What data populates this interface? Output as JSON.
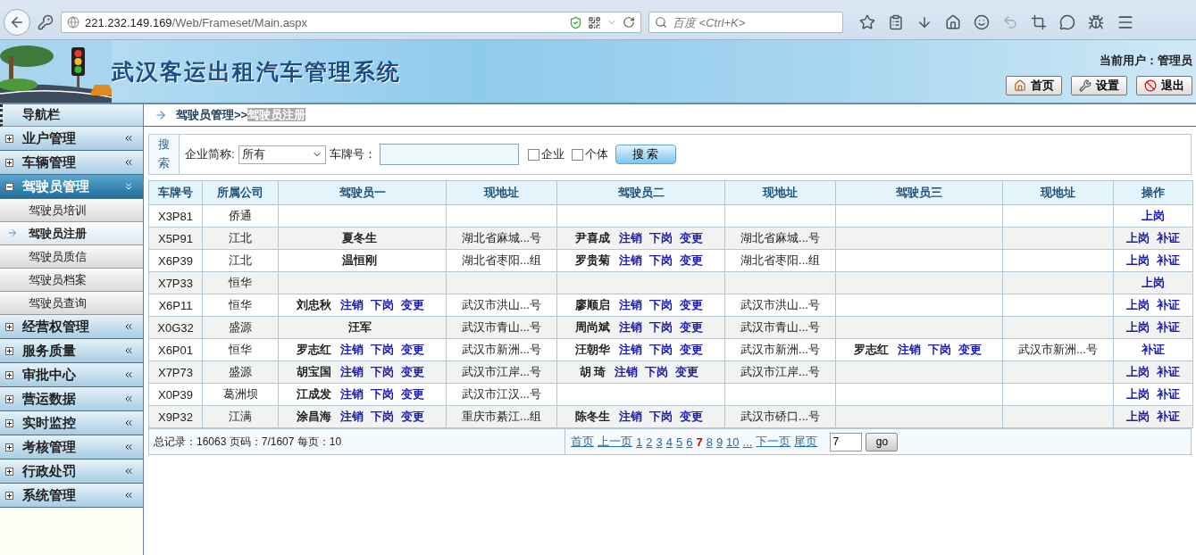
{
  "browser": {
    "url_host": "221.232.149.169",
    "url_path": "/Web/Frameset/Main.aspx",
    "search_placeholder": "百度 <Ctrl+K>"
  },
  "header": {
    "title": "武汉客运出租汽车管理系统",
    "user": "当前用户：管理员",
    "buttons": [
      {
        "kind": "home",
        "label": "首页"
      },
      {
        "kind": "settings",
        "label": "设置"
      },
      {
        "kind": "logout",
        "label": "退出"
      }
    ]
  },
  "sidebar": {
    "title": "导航栏",
    "groups": [
      {
        "label": "业户管理",
        "expanded": false
      },
      {
        "label": "车辆管理",
        "expanded": false
      },
      {
        "label": "驾驶员管理",
        "expanded": true,
        "children": [
          {
            "label": "驾驶员培训",
            "selected": false
          },
          {
            "label": "驾驶员注册",
            "selected": true
          },
          {
            "label": "驾驶员质信",
            "selected": false
          },
          {
            "label": "驾驶员档案",
            "selected": false
          },
          {
            "label": "驾驶员查询",
            "selected": false
          }
        ]
      },
      {
        "label": "经营权管理",
        "expanded": false
      },
      {
        "label": "服务质量",
        "expanded": false
      },
      {
        "label": "审批中心",
        "expanded": false
      },
      {
        "label": "营运数据",
        "expanded": false
      },
      {
        "label": "实时监控",
        "expanded": false
      },
      {
        "label": "考核管理",
        "expanded": false
      },
      {
        "label": "行政处罚",
        "expanded": false
      },
      {
        "label": "系统管理",
        "expanded": false
      }
    ]
  },
  "breadcrumb": {
    "parent": "驾驶员管理>>",
    "current": "驾驶员注册"
  },
  "search": {
    "label": "搜索",
    "company_label": "企业简称:",
    "company_value": "所有",
    "plate_label": "车牌号：",
    "checkboxes": [
      {
        "label": "企业",
        "checked": false
      },
      {
        "label": "个体",
        "checked": false
      }
    ],
    "button": "搜 索"
  },
  "table": {
    "columns": [
      "车牌号",
      "所属公司",
      "驾驶员一",
      "现地址",
      "驾驶员二",
      "现地址",
      "驾驶员三",
      "现地址",
      "操作"
    ],
    "rows": [
      {
        "plate": "X3P81",
        "company": "侨通",
        "operations": [
          "上岗"
        ]
      },
      {
        "plate": "X5P91",
        "company": "江北",
        "driver_1": {
          "name": "夏冬生",
          "address": "湖北省麻城...号"
        },
        "driver_2": {
          "name": "尹喜成",
          "actions": [
            "注销",
            "下岗",
            "变更"
          ],
          "address": "湖北省麻城...号"
        },
        "operations": [
          "上岗",
          "补证"
        ]
      },
      {
        "plate": "X6P39",
        "company": "江北",
        "driver_1": {
          "name": "温恒刚",
          "address": "湖北省枣阳...组"
        },
        "driver_2": {
          "name": "罗贵菊",
          "actions": [
            "注销",
            "下岗",
            "变更"
          ],
          "address": "湖北省枣阳...组"
        },
        "operations": [
          "上岗",
          "补证"
        ]
      },
      {
        "plate": "X7P33",
        "company": "恒华",
        "operations": [
          "上岗"
        ]
      },
      {
        "plate": "X6P11",
        "company": "恒华",
        "driver_1": {
          "name": "刘忠秋",
          "actions": [
            "注销",
            "下岗",
            "变更"
          ],
          "address": "武汉市洪山...号"
        },
        "driver_2": {
          "name": "廖顺启",
          "actions": [
            "注销",
            "下岗",
            "变更"
          ],
          "address": "武汉市洪山...号"
        },
        "operations": [
          "上岗",
          "补证"
        ]
      },
      {
        "plate": "X0G32",
        "company": "盛源",
        "driver_1": {
          "name": "汪军",
          "address": "武汉市青山...号"
        },
        "driver_2": {
          "name": "周尚斌",
          "actions": [
            "注销",
            "下岗",
            "变更"
          ],
          "address": "武汉市青山...号"
        },
        "operations": [
          "上岗",
          "补证"
        ]
      },
      {
        "plate": "X6P01",
        "company": "恒华",
        "driver_1": {
          "name": "罗志红",
          "actions": [
            "注销",
            "下岗",
            "变更"
          ],
          "address": "武汉市新洲...号"
        },
        "driver_2": {
          "name": "汪朝华",
          "actions": [
            "注销",
            "下岗",
            "变更"
          ],
          "address": "武汉市新洲...号"
        },
        "driver_3": {
          "name": "罗志红",
          "actions": [
            "注销",
            "下岗",
            "变更"
          ],
          "address": "武汉市新洲...号"
        },
        "operations": [
          "补证"
        ]
      },
      {
        "plate": "X7P73",
        "company": "盛源",
        "driver_1": {
          "name": "胡宝国",
          "actions": [
            "注销",
            "下岗",
            "变更"
          ],
          "address": "武汉市江岸...号"
        },
        "driver_2": {
          "name": "胡 琦",
          "actions": [
            "注销",
            "下岗",
            "变更"
          ],
          "address": "武汉市江岸...号"
        },
        "operations": [
          "上岗",
          "补证"
        ]
      },
      {
        "plate": "X0P39",
        "company": "葛洲坝",
        "driver_1": {
          "name": "江成发",
          "actions": [
            "注销",
            "下岗",
            "变更"
          ],
          "address": "武汉市江汉...号"
        },
        "operations": [
          "上岗",
          "补证"
        ]
      },
      {
        "plate": "X9P32",
        "company": "江满",
        "driver_1": {
          "name": "涂昌海",
          "actions": [
            "注销",
            "下岗",
            "变更"
          ],
          "address": "重庆市綦江...组"
        },
        "driver_2": {
          "name": "陈冬生",
          "actions": [
            "注销",
            "下岗",
            "变更"
          ],
          "address": "武汉市硚口...号"
        },
        "operations": [
          "上岗",
          "补证"
        ]
      }
    ]
  },
  "footer": {
    "summary": "总记录：16063 页码：7/1607 每页：10",
    "first": "首页",
    "prev": "上一页",
    "pages": [
      {
        "label": "1",
        "selected": false
      },
      {
        "label": "2",
        "selected": false
      },
      {
        "label": "3",
        "selected": false
      },
      {
        "label": "4",
        "selected": false
      },
      {
        "label": "5",
        "selected": false
      },
      {
        "label": "6",
        "selected": false
      },
      {
        "label": "7",
        "selected": true
      },
      {
        "label": "8",
        "selected": false
      },
      {
        "label": "9",
        "selected": false
      },
      {
        "label": "10",
        "selected": false
      },
      {
        "label": "...",
        "selected": false
      }
    ],
    "next": "下一页",
    "last": "尾页",
    "page_input": "7",
    "go": "go"
  }
}
